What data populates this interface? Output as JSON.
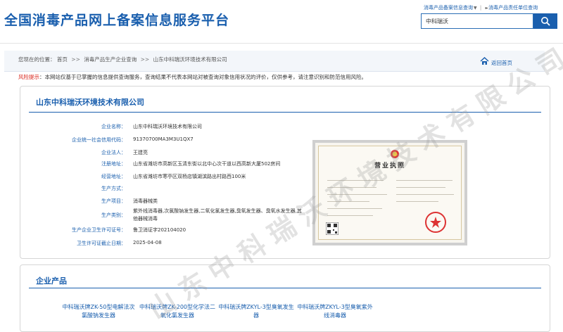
{
  "header": {
    "site_title": "全国消毒产品网上备案信息服务平台",
    "link_1": "消毒产品备案信息查询",
    "link_2": "消毒产品责任单位查询",
    "search_value": "中科瑞沃"
  },
  "breadcrumb": {
    "prefix": "您现在的位置：",
    "items": [
      "首页",
      "消毒产品生产企业查询",
      "山东中科瑞沃环境技术有限公司"
    ],
    "home_label": "返回首页"
  },
  "risk": {
    "label": "风险提示",
    "text": "：本网站仅基于已掌握的信息提供查询服务，查询结果不代表本网站对被查询对象信用状况的评价，仅供参考，请注意识别和防范信用风险。"
  },
  "company": {
    "title": "山东中科瑞沃环境技术有限公司",
    "rows": [
      {
        "label": "企业名称：",
        "value": "山东中科瑞沃环境技术有限公司"
      },
      {
        "label": "企业统一社会信用代码：",
        "value": "91370700MA3M3U1QX7"
      },
      {
        "label": "企业法人：",
        "value": "王建亮"
      },
      {
        "label": "注册地址：",
        "value": "山东省潍坊市高新区玉清东街以北中心次干道以西高新大厦502房间"
      },
      {
        "label": "经营地址：",
        "value": "山东省潍坊市寒亭区双杨店镇湖滨路出村路西100米"
      },
      {
        "label": "生产方式：",
        "value": ""
      },
      {
        "label": "生产项目：",
        "value": "消毒器械类"
      },
      {
        "label": "生产类别：",
        "value": "紫外线消毒器,次氯酸钠发生器,二氧化氯发生器,臭氧发生器、臭氧水发生器,其他器械消毒"
      },
      {
        "label": "生产企业卫生许可证号：",
        "value": "鲁卫消证字202104020"
      },
      {
        "label": "卫生许可证截止日期：",
        "value": "2025-04-08"
      }
    ]
  },
  "license": {
    "title": "营业执照"
  },
  "products": {
    "title": "企业产品",
    "items": [
      "中科瑞沃牌ZK-50型电解法次氯酸钠发生器",
      "中科瑞沃牌ZK-200型化学法二氧化氯发生器",
      "中科瑞沃牌ZKYL-3型臭氧发生器",
      "中科瑞沃牌ZKYL-3型臭氧紫外线消毒器"
    ]
  },
  "watermark": {
    "text": "山东中科瑞沃环境技术有限公司"
  },
  "colors": {
    "brand_blue": "#1a5fae",
    "risk_red": "#d9251c",
    "watermark_gray": "#a0a0a0"
  }
}
